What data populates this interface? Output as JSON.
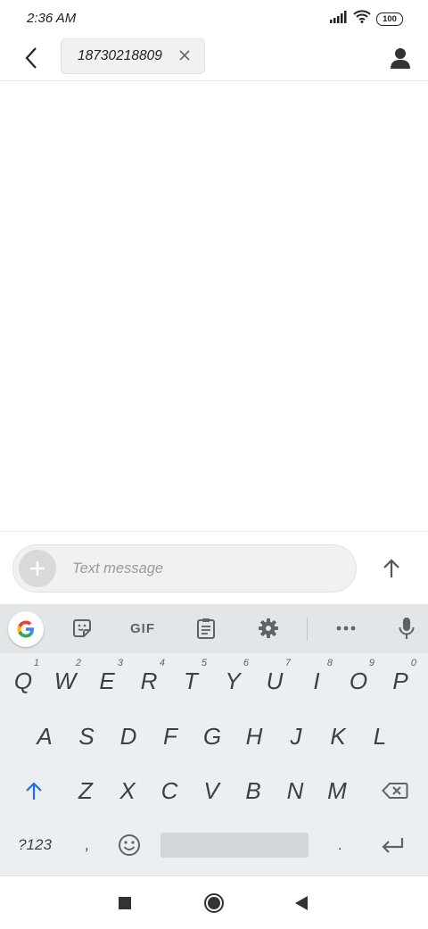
{
  "status_bar": {
    "time": "2:36 AM",
    "battery": "100",
    "icons": [
      "signal-icon",
      "wifi-icon",
      "battery-icon"
    ]
  },
  "header": {
    "recipient": "18730218809",
    "back_icon": "back-arrow-icon",
    "contact_icon": "person-icon"
  },
  "compose": {
    "placeholder": "Text message",
    "value": ""
  },
  "keyboard": {
    "toolbar": [
      "google-icon",
      "sticker-icon",
      "GIF",
      "clipboard-icon",
      "gear-icon",
      "more-icon",
      "mic-icon"
    ],
    "gif_label": "GIF",
    "row1": [
      {
        "key": "Q",
        "hint": "1"
      },
      {
        "key": "W",
        "hint": "2"
      },
      {
        "key": "E",
        "hint": "3"
      },
      {
        "key": "R",
        "hint": "4"
      },
      {
        "key": "T",
        "hint": "5"
      },
      {
        "key": "Y",
        "hint": "6"
      },
      {
        "key": "U",
        "hint": "7"
      },
      {
        "key": "I",
        "hint": "8"
      },
      {
        "key": "O",
        "hint": "9"
      },
      {
        "key": "P",
        "hint": "0"
      }
    ],
    "row2": [
      "A",
      "S",
      "D",
      "F",
      "G",
      "H",
      "J",
      "K",
      "L"
    ],
    "row3": [
      "Z",
      "X",
      "C",
      "V",
      "B",
      "N",
      "M"
    ],
    "row4": {
      "symbols": "?123",
      "comma": ",",
      "period": "."
    }
  },
  "nav_bar": [
    "recents-icon",
    "home-icon",
    "back-triangle-icon"
  ]
}
